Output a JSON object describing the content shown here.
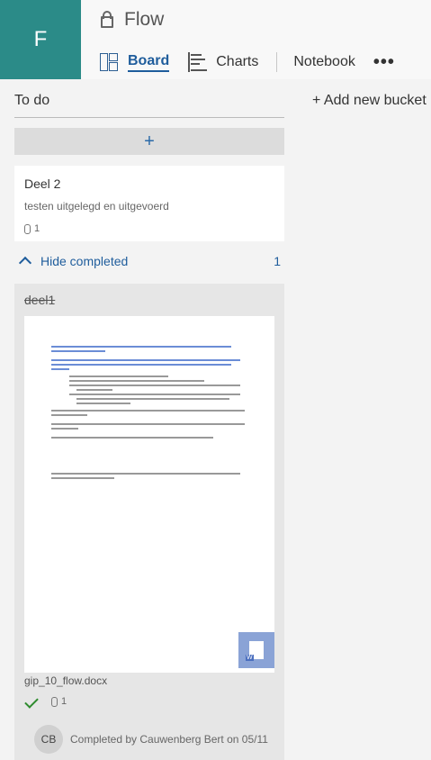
{
  "header": {
    "avatar_letter": "F",
    "plan_name": "Flow",
    "tabs": [
      {
        "label": "Board",
        "active": true
      },
      {
        "label": "Charts"
      },
      {
        "label": "Notebook"
      }
    ],
    "more": "•••"
  },
  "bucket": {
    "title": "To do",
    "add_task": "+",
    "add_bucket": "+ Add new bucket"
  },
  "task": {
    "title": "Deel 2",
    "description": "testen uitgelegd en uitgevoerd",
    "attachments": "1"
  },
  "completed_toggle": {
    "label": "Hide completed",
    "count": "1"
  },
  "completed_task": {
    "title": "deel1",
    "attachment_name": "gip_10_flow.docx",
    "attachments": "1",
    "avatar_initials": "CB",
    "completed_text": "Completed by Cauwenberg Bert on 05/11"
  },
  "colors": {
    "accent": "#1f5d9c",
    "plan_tile": "#2b8b88",
    "done_check": "#2e8b2e"
  }
}
